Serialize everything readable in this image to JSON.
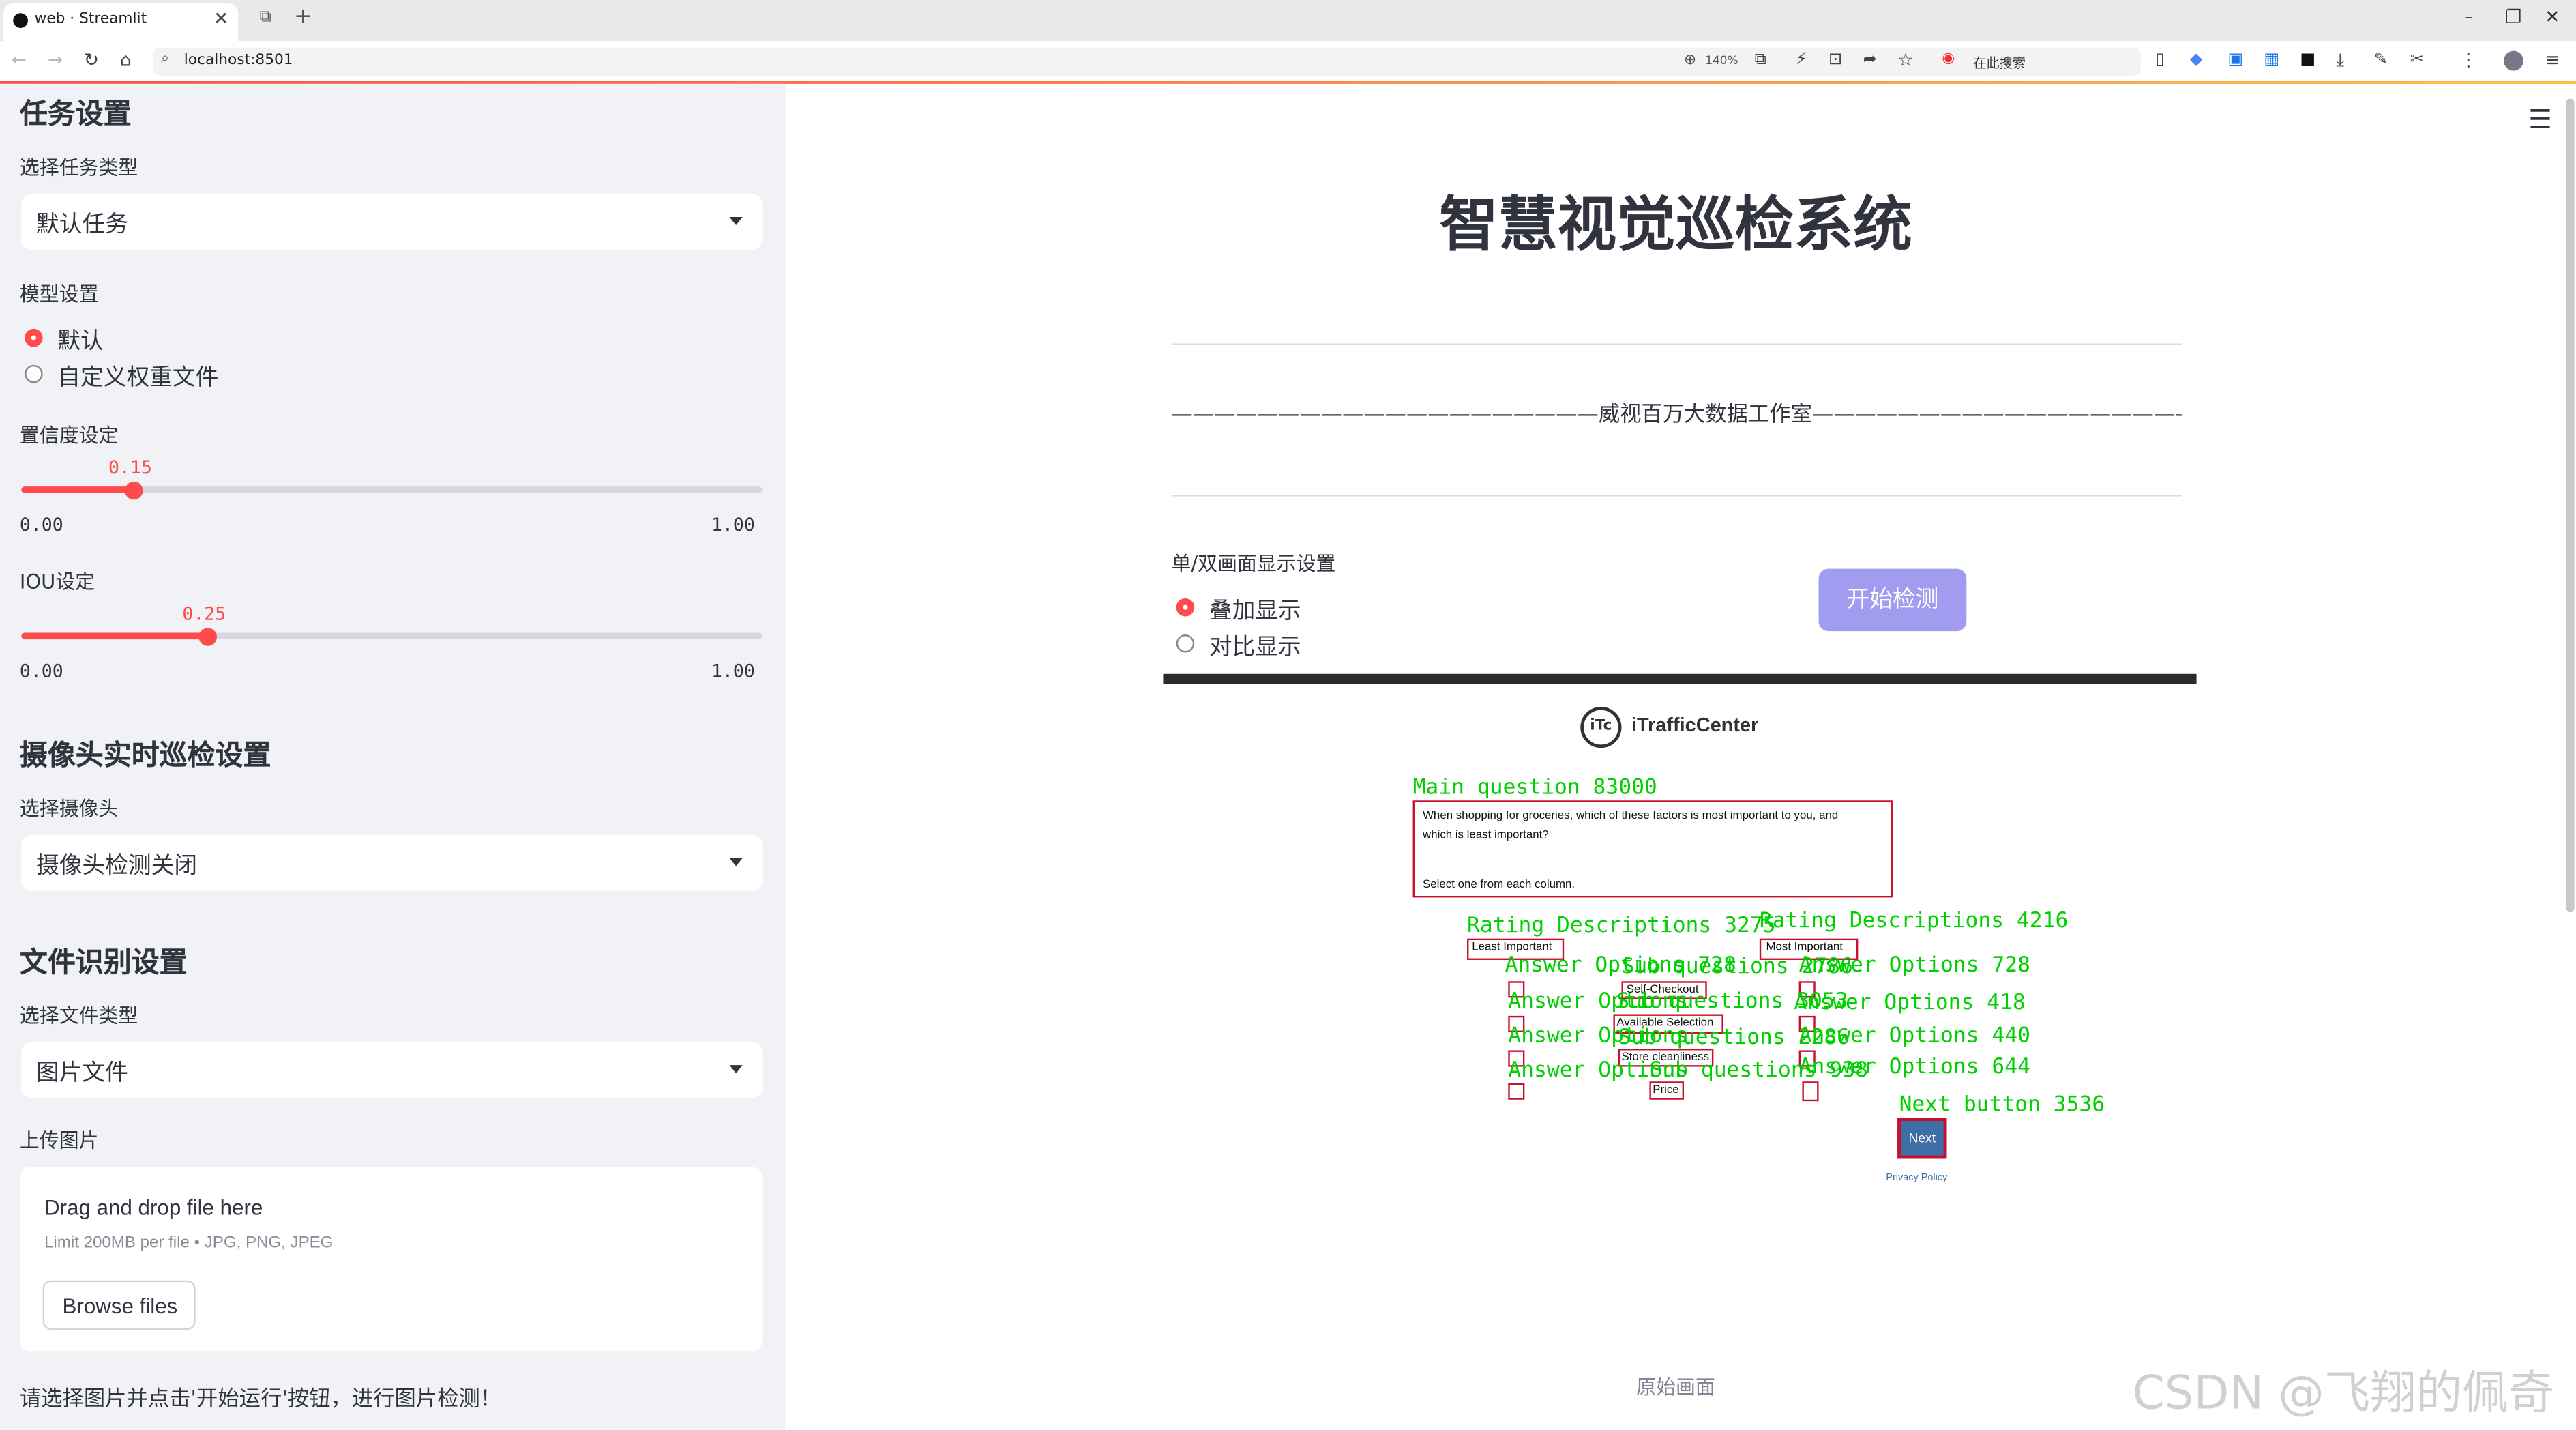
{
  "browser": {
    "tab_title": "web · Streamlit",
    "url": "localhost:8501",
    "zoom": "140%",
    "search_placeholder": "在此搜索"
  },
  "sidebar": {
    "task_section_title": "任务设置",
    "task_type_label": "选择任务类型",
    "task_type_value": "默认任务",
    "model_label": "模型设置",
    "model_options": [
      "默认",
      "自定义权重文件"
    ],
    "model_selected": "默认",
    "conf_label": "置信度设定",
    "conf_value": "0.15",
    "conf_fraction": 0.15,
    "conf_min": "0.00",
    "conf_max": "1.00",
    "iou_label": "IOU设定",
    "iou_value": "0.25",
    "iou_fraction": 0.25,
    "iou_min": "0.00",
    "iou_max": "1.00",
    "camera_section_title": "摄像头实时巡检设置",
    "camera_label": "选择摄像头",
    "camera_value": "摄像头检测关闭",
    "file_section_title": "文件识别设置",
    "file_type_label": "选择文件类型",
    "file_type_value": "图片文件",
    "upload_label": "上传图片",
    "drop_text": "Drag and drop file here",
    "limit_text": "Limit 200MB per file • JPG, PNG, JPEG",
    "browse_label": "Browse files",
    "hint_text": "请选择图片并点击'开始运行'按钮，进行图片检测！"
  },
  "main": {
    "title": "智慧视觉巡检系统",
    "subtitle": "————————————————————威视百万大数据工作室————————————————————",
    "display_label": "单/双画面显示设置",
    "display_options": [
      "叠加显示",
      "对比显示"
    ],
    "display_selected": "叠加显示",
    "start_button": "开始检测",
    "image_caption": "原始画面",
    "watermark": "CSDN @飞翔的佩奇"
  },
  "detection_image": {
    "logo_text": "iTrafficCenter",
    "question_text_1": "When shopping for groceries, which of these factors is most important to you, and",
    "question_text_2": "which is least important?",
    "question_text_3": "Select one from each column.",
    "col_left": "Least Important",
    "col_right": "Most Important",
    "rows": [
      "Self-Checkout",
      "Available Selection",
      "Store cleanliness",
      "Price"
    ],
    "next_label": "Next",
    "privacy": "Privacy Policy",
    "labels": {
      "main_question": "Main question 83000",
      "rating_left": "Rating Descriptions 3275",
      "rating_right": "Rating Descriptions 4216",
      "answer_l1": "Answer Options 728",
      "sub_1": "Sub questions 2786",
      "answer_r1": "Answer Options 728",
      "answer_l2": "Answer Options",
      "sub_2": "Sub questions 3053",
      "answer_r2": "Answer Options 418",
      "answer_l3": "Answer Options",
      "sub_3": "Sub questions 2286",
      "answer_r3": "Answer Options 440",
      "answer_l4": "Answer Options",
      "sub_4": "Sub questions 938",
      "answer_r4": "Answer Options 644",
      "next_button": "Next button 3536"
    }
  }
}
